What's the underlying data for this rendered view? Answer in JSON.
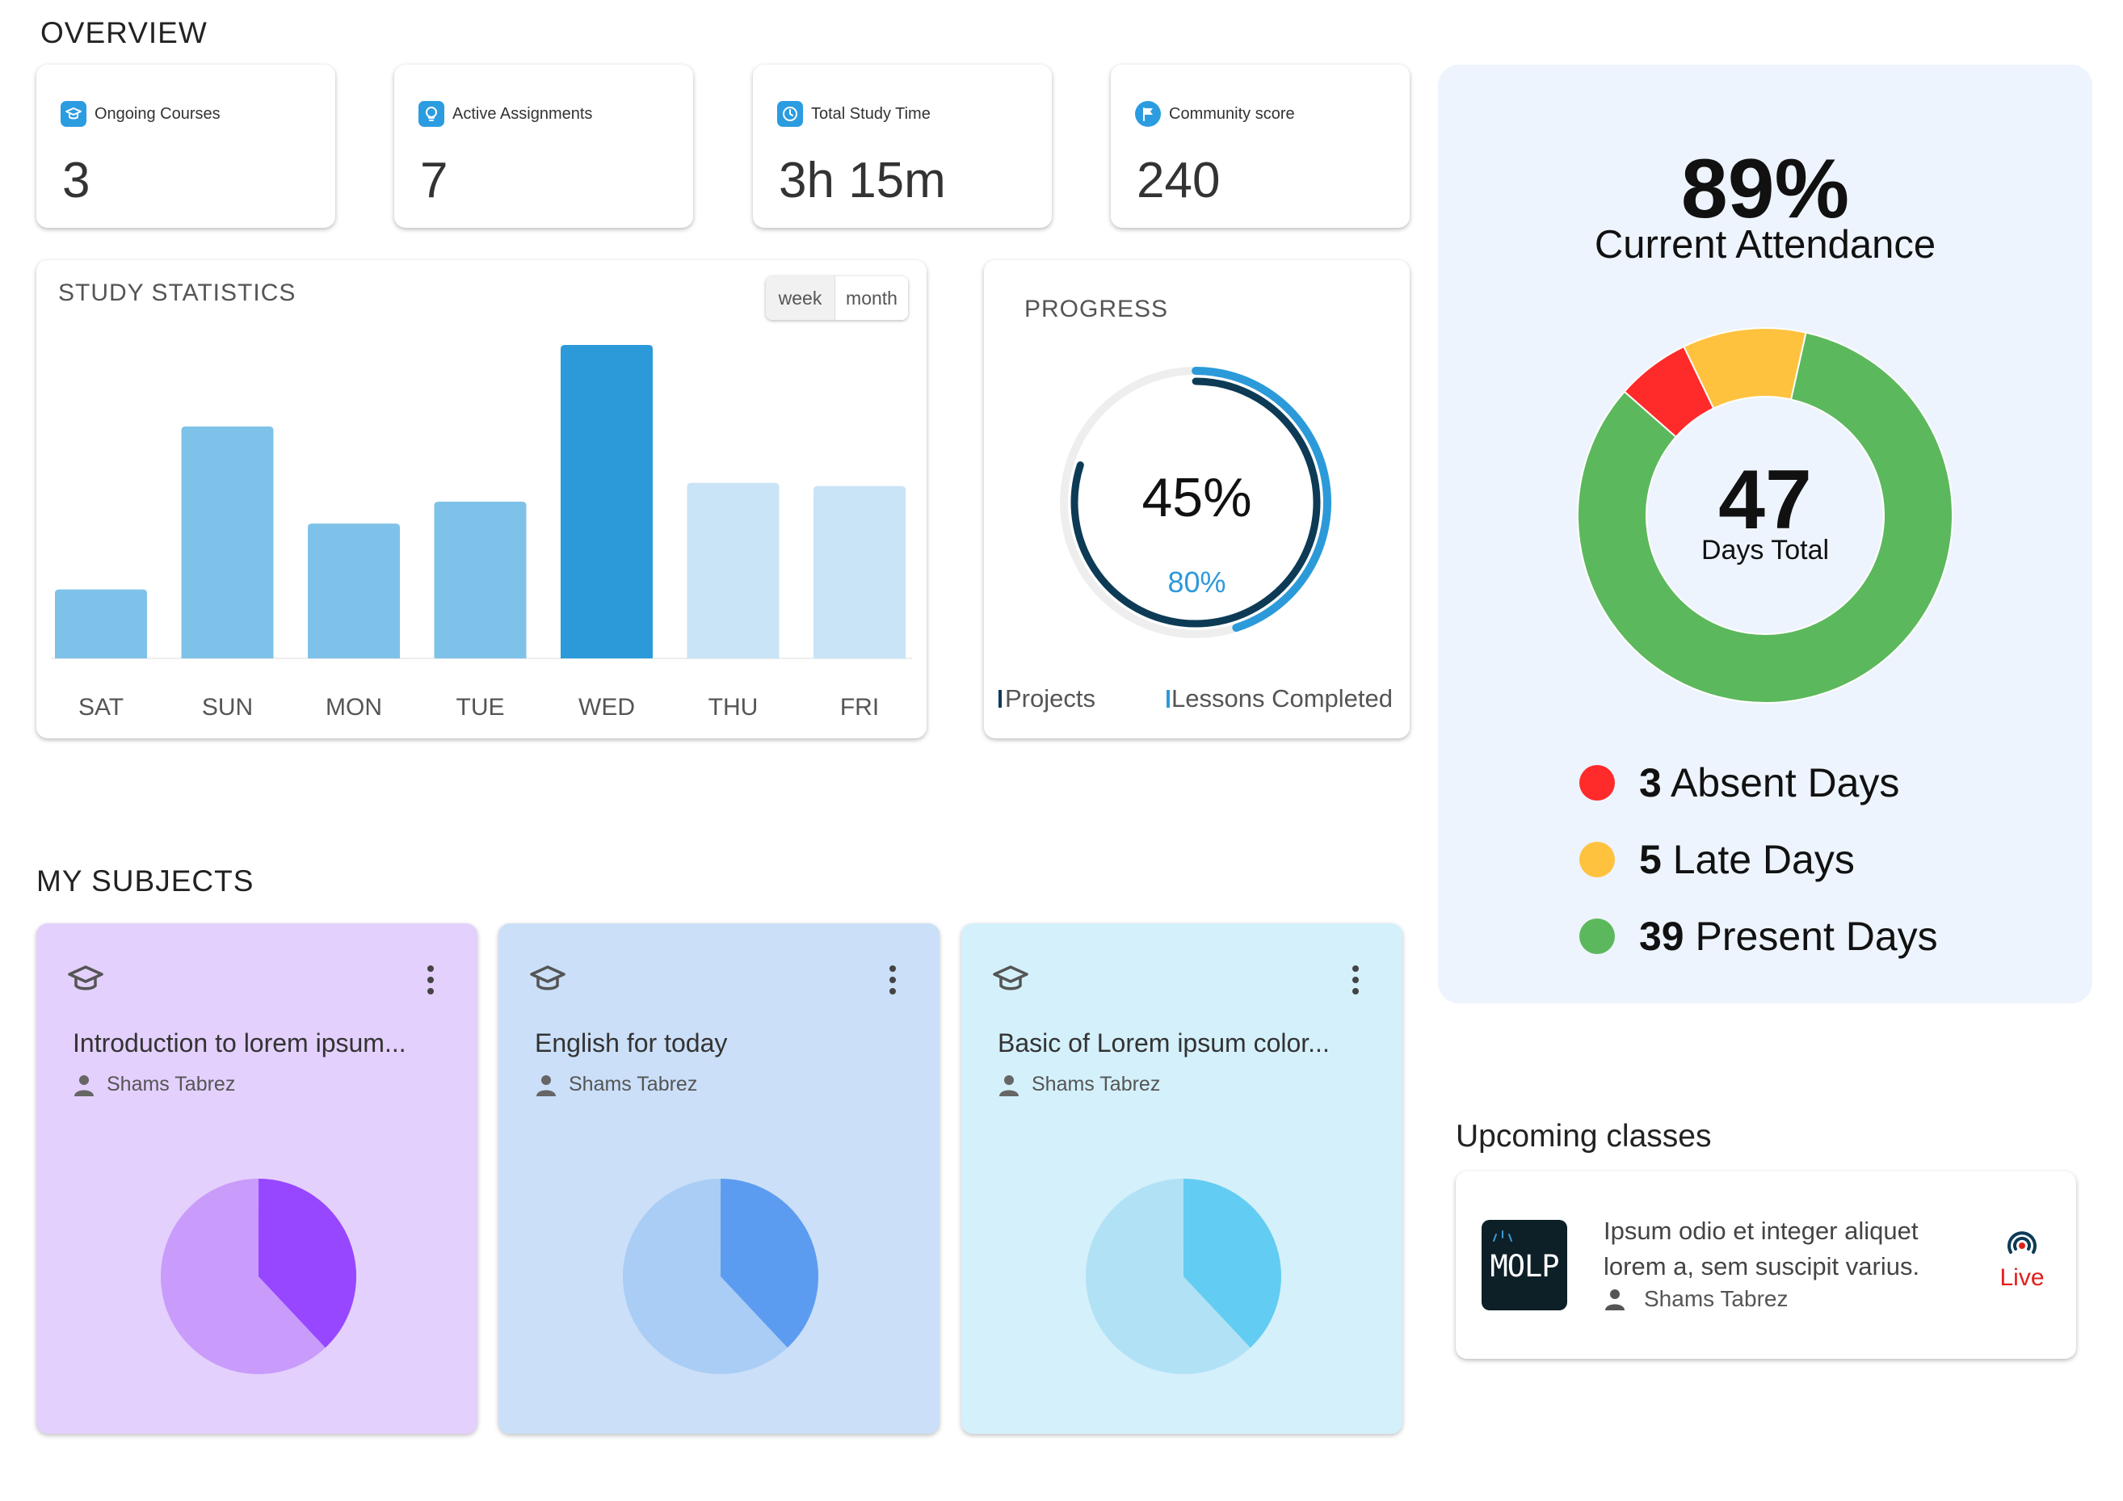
{
  "overview": {
    "title": "OVERVIEW"
  },
  "stats": [
    {
      "label": "Ongoing Courses",
      "value": "3",
      "icon": "graduation-cap-icon"
    },
    {
      "label": "Active Assignments",
      "value": "7",
      "icon": "lightbulb-icon"
    },
    {
      "label": "Total Study Time",
      "value": "3h 15m",
      "icon": "clock-icon"
    },
    {
      "label": "Community score",
      "value": "240",
      "icon": "flag-icon"
    }
  ],
  "study_statistics": {
    "title": "STUDY STATISTICS",
    "toggle": {
      "week": "week",
      "month": "month",
      "selected": "week"
    },
    "chart_data": {
      "type": "bar",
      "categories": [
        "SAT",
        "SUN",
        "MON",
        "TUE",
        "WED",
        "THU",
        "FRI"
      ],
      "values": [
        22,
        74,
        43,
        50,
        100,
        56,
        55
      ],
      "colors": [
        "#7fc2e9",
        "#7fc2e9",
        "#7fc2e9",
        "#7fc2e9",
        "#2c9ad9",
        "#c9e4f6",
        "#c9e4f6"
      ],
      "ylim": [
        0,
        100
      ],
      "grid": false
    }
  },
  "progress": {
    "title": "PROGRESS",
    "chart_data": {
      "type": "radial",
      "series": [
        {
          "name": "Projects",
          "value": 80,
          "color": "#0d3b56"
        },
        {
          "name": "Lessons Completed",
          "value": 45,
          "color": "#2c9ad9"
        }
      ]
    },
    "center_label": "45%",
    "inner_label": "80%",
    "legend": [
      "Projects",
      "Lessons Completed"
    ]
  },
  "attendance": {
    "percent": "89%",
    "label": "Current Attendance",
    "total_number": "47",
    "total_label": "Days Total",
    "chart_data": {
      "type": "pie",
      "labels": [
        "Absent Days",
        "Late Days",
        "Present Days"
      ],
      "values": [
        3,
        5,
        39
      ],
      "colors": [
        "#ff2a2a",
        "#ffc23f",
        "#5cb85c"
      ]
    },
    "legend": [
      {
        "count": "3",
        "label": "Absent Days",
        "color": "#ff2a2a"
      },
      {
        "count": "5",
        "label": "Late Days",
        "color": "#ffc23f"
      },
      {
        "count": "39",
        "label": "Present Days",
        "color": "#5cb85c"
      }
    ]
  },
  "subjects": {
    "title": "MY SUBJECTS",
    "items": [
      {
        "title": "Introduction to lorem ipsum...",
        "author": "Shams Tabrez",
        "bg": "#e3d0fc",
        "light": "#c99bfb",
        "dark": "#9747ff",
        "progress": 0.38
      },
      {
        "title": "English for today",
        "author": "Shams Tabrez",
        "bg": "#cbdff8",
        "light": "#a9cdf4",
        "dark": "#5c9cf0",
        "progress": 0.38
      },
      {
        "title": "Basic of Lorem ipsum color...",
        "author": "Shams Tabrez",
        "bg": "#d4f0fb",
        "light": "#b1e1f5",
        "dark": "#63ccf2",
        "progress": 0.38
      }
    ]
  },
  "upcoming": {
    "title": "Upcoming classes",
    "item": {
      "logo_text": "MOLP",
      "description": "Ipsum odio et integer aliquet lorem a, sem suscipit varius.",
      "author": "Shams Tabrez",
      "live_label": "Live"
    }
  }
}
